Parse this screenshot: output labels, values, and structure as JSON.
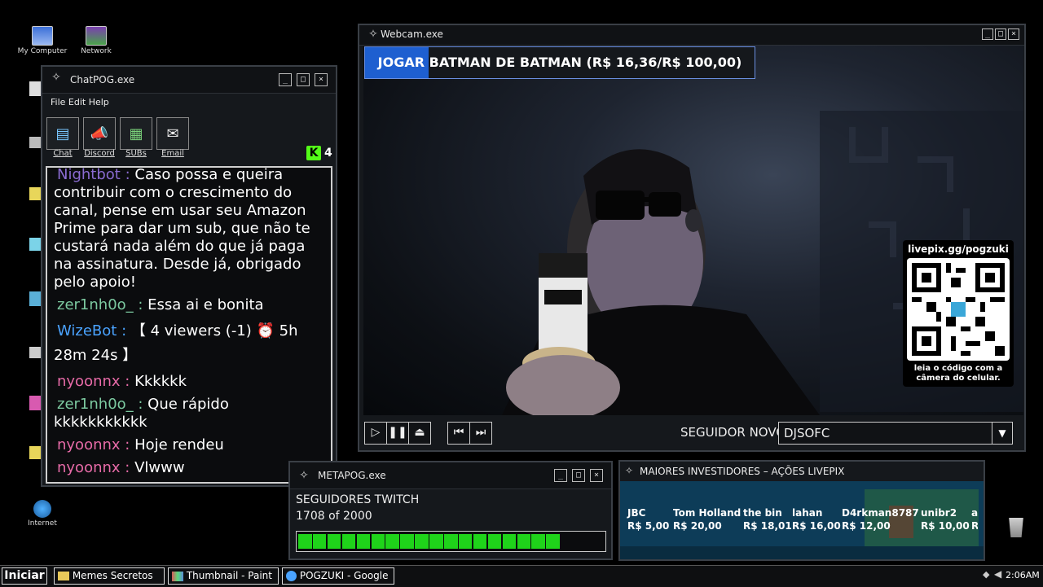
{
  "desktop": {
    "icons": [
      {
        "label": "My Computer"
      },
      {
        "label": "Network"
      },
      {
        "label": "Internet"
      }
    ]
  },
  "chat_window": {
    "title": "ChatPOG.exe",
    "menu": "File Edit Help",
    "tools": [
      {
        "label": "Chat",
        "icon": "chat-icon"
      },
      {
        "label": "Discord",
        "icon": "megaphone-icon"
      },
      {
        "label": "SUBs",
        "icon": "subs-icon"
      },
      {
        "label": "Email",
        "icon": "mail-icon"
      }
    ],
    "viewer_count": "4",
    "messages": [
      {
        "nick": "Nightbot",
        "sep": " : ",
        "text": "Caso possa e queira contribuir com o crescimento do canal, pense em usar seu Amazon Prime para dar um sub, que não te custará nada além do que já paga na assinatura. Desde já, obrigado pelo apoio!"
      },
      {
        "nick": "zer1nh0o_",
        "sep": " : ",
        "text": "Essa ai e bonita"
      },
      {
        "nick": "WizeBot",
        "sep": " : ",
        "text": "【 4 viewers (-1) ⏰ 5h 28m 24s 】"
      },
      {
        "nick": "nyoonnx",
        "sep": " : ",
        "text": "Kkkkkk"
      },
      {
        "nick": "zer1nh0o_",
        "sep": " : ",
        "text": "Que rápido kkkkkkkkkkk"
      },
      {
        "nick": "nyoonnx",
        "sep": " : ",
        "text": "Hoje rendeu"
      },
      {
        "nick": "nyoonnx",
        "sep": " : ",
        "text": "Vlwww"
      }
    ]
  },
  "webcam_window": {
    "title": "Webcam.exe",
    "goal_banner": "JOGAR BATMAN DE BATMAN (R$ 16,36/R$ 100,00)",
    "goal_progress": 0.1636,
    "qr_url": "livepix.gg/pogzuki",
    "qr_caption_1": "leia o código com a",
    "qr_caption_2": "câmera do celular.",
    "new_follower_label": "SEGUIDOR NOVO",
    "new_follower_name": "DJSOFC"
  },
  "meta_window": {
    "title": "METAPOG.exe",
    "heading": "SEGUIDORES TWITCH",
    "count_text": "1708 of 2000",
    "progress": 0.854
  },
  "investors_panel": {
    "title": "MAIORES INVESTIDORES – AÇÕES LIVEPIX",
    "items": [
      {
        "name": "JBC",
        "amount": "R$ 5,00"
      },
      {
        "name": "Tom Holland",
        "amount": "R$ 20,00"
      },
      {
        "name": "the bin",
        "amount": "R$ 18,01"
      },
      {
        "name": "lahan",
        "amount": "R$ 16,00"
      },
      {
        "name": "D4rkman8787",
        "amount": "R$ 12,00"
      },
      {
        "name": "unibr2",
        "amount": "R$ 10,00"
      },
      {
        "name": "al",
        "amount": "R"
      }
    ]
  },
  "taskbar": {
    "start_label": "Iniciar",
    "tasks": [
      {
        "label": "Memes Secretos"
      },
      {
        "label": "Thumbnail - Paint"
      },
      {
        "label": "POGZUKI - Google"
      }
    ],
    "clock": "2:06AM"
  },
  "colors": {
    "accent_blue": "#1e5fd0",
    "progress_green": "#1fd31a",
    "nick_pink": "#e86ba8",
    "nick_green": "#7cc9a0",
    "nick_blue": "#4aa3ff"
  }
}
